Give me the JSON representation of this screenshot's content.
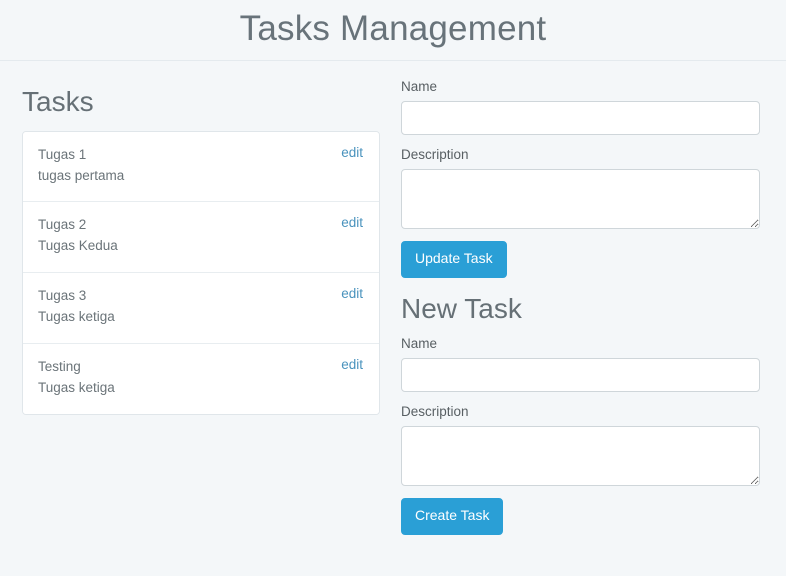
{
  "header": {
    "title": "Tasks Management"
  },
  "tasks_section": {
    "heading": "Tasks",
    "edit_label": "edit",
    "items": [
      {
        "name": "Tugas 1",
        "description": "tugas pertama"
      },
      {
        "name": "Tugas 2",
        "description": "Tugas Kedua"
      },
      {
        "name": "Tugas 3",
        "description": "Tugas ketiga"
      },
      {
        "name": "Testing",
        "description": "Tugas ketiga"
      }
    ]
  },
  "update_form": {
    "name_label": "Name",
    "name_value": "",
    "name_placeholder": "",
    "description_label": "Description",
    "description_value": "",
    "description_placeholder": "",
    "submit_label": "Update Task"
  },
  "new_task_form": {
    "heading": "New Task",
    "name_label": "Name",
    "name_value": "",
    "name_placeholder": "",
    "description_label": "Description",
    "description_value": "",
    "description_placeholder": "",
    "submit_label": "Create Task"
  },
  "colors": {
    "page_background": "#f4f7f9",
    "card_background": "#ffffff",
    "primary_button": "#2a9fd6",
    "link": "#4a93bd",
    "heading_text": "#667076",
    "body_text": "#6b7479",
    "border": "#e0e6ea"
  }
}
